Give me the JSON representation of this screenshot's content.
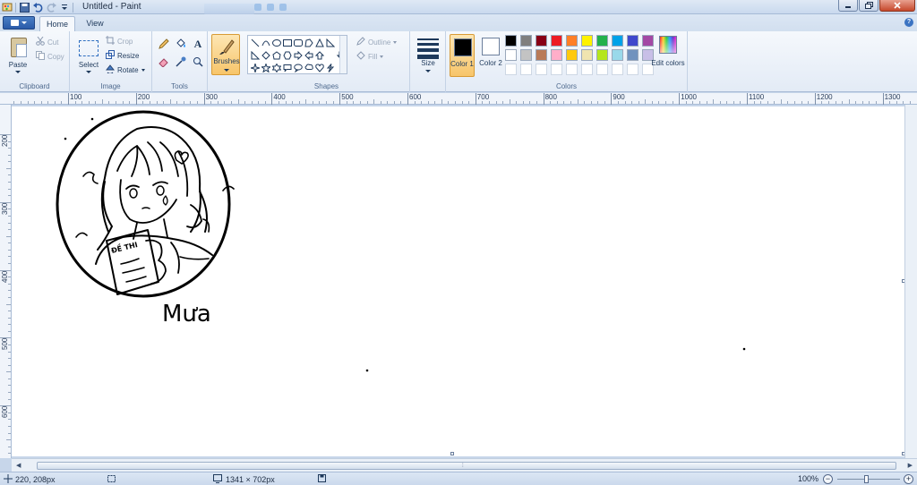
{
  "window": {
    "title": "Untitled - Paint"
  },
  "tabs": {
    "file": "",
    "home": "Home",
    "view": "View"
  },
  "clipboard": {
    "paste": "Paste",
    "cut": "Cut",
    "copy": "Copy",
    "label": "Clipboard"
  },
  "image": {
    "select": "Select",
    "crop": "Crop",
    "resize": "Resize",
    "rotate": "Rotate",
    "label": "Image"
  },
  "tools": {
    "label": "Tools"
  },
  "brushes": {
    "label": "Brushes"
  },
  "shapes": {
    "outline": "Outline",
    "fill": "Fill",
    "label": "Shapes"
  },
  "size": {
    "label": "Size"
  },
  "colors": {
    "color1_label": "Color 1",
    "color2_label": "Color 2",
    "color1_value": "#000000",
    "color2_value": "#ffffff",
    "edit_label": "Edit colors",
    "label": "Colors",
    "palette": [
      "#000000",
      "#7f7f7f",
      "#880015",
      "#ed1c24",
      "#ff7f27",
      "#fff200",
      "#22b14c",
      "#00a2e8",
      "#3f48cc",
      "#a349a4",
      "#ffffff",
      "#c3c3c3",
      "#b97a57",
      "#ffaec9",
      "#ffc90e",
      "#efe4b0",
      "#b5e61d",
      "#99d9ea",
      "#7092be",
      "#c8bfe7",
      "#ffffff",
      "#ffffff",
      "#ffffff",
      "#ffffff",
      "#ffffff",
      "#ffffff",
      "#ffffff",
      "#ffffff",
      "#ffffff",
      "#ffffff"
    ]
  },
  "ruler": {
    "horizontal": [
      "100",
      "200",
      "300",
      "400",
      "500",
      "600",
      "700",
      "800",
      "900",
      "1000",
      "1100",
      "1200",
      "1300"
    ],
    "vertical": [
      "200",
      "300",
      "400",
      "500",
      "600",
      "700"
    ]
  },
  "drawing": {
    "signature": "Mưa",
    "note_text": "ĐỀ THI"
  },
  "status": {
    "cursor_position": "220, 208px",
    "selection_size": "",
    "image_size": "1341 × 702px",
    "zoom": "100%"
  }
}
